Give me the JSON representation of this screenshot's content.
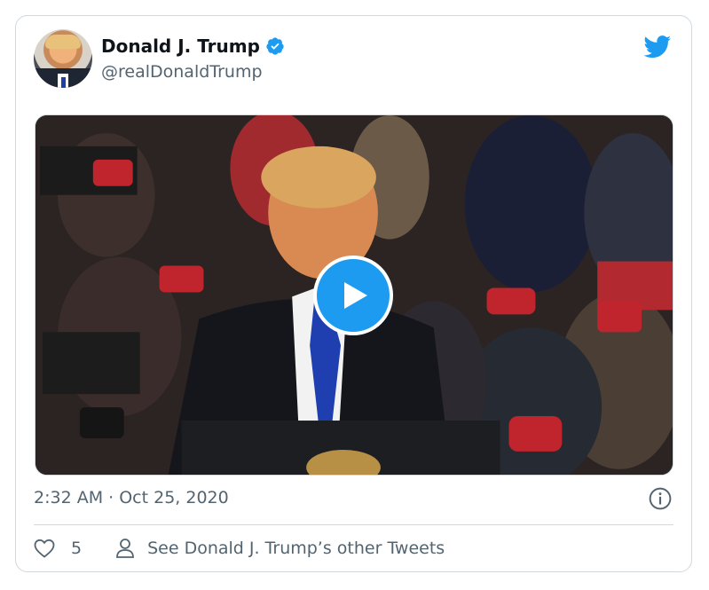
{
  "tweet": {
    "author_name": "Donald J. Trump",
    "handle": "@realDonaldTrump",
    "timestamp": "2:32 AM · Oct 25, 2020",
    "like_count": "5",
    "other_tweets_link": "See Donald J. Trump’s other Tweets"
  },
  "colors": {
    "accent": "#1d9bf0",
    "text_primary": "#0f1419",
    "text_secondary": "#536471",
    "border": "#cfd9de"
  },
  "icons": {
    "verified": "verified-badge-icon",
    "brand": "twitter-bird-icon",
    "play": "play-icon",
    "info": "info-icon",
    "like": "heart-icon",
    "profile": "person-icon"
  }
}
